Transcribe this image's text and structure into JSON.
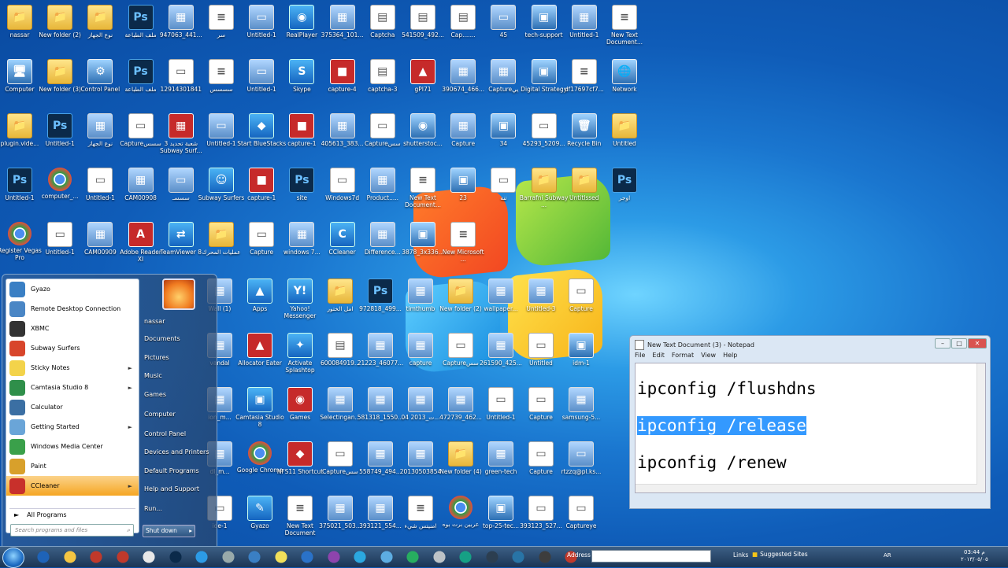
{
  "desktop": {
    "icons": [
      {
        "label": "nassar",
        "glyph": "📁",
        "kind": "g-folder"
      },
      {
        "label": "New folder (2)",
        "glyph": "📁",
        "kind": "g-folder"
      },
      {
        "label": "نوع الجهاز",
        "glyph": "📁",
        "kind": "g-folder"
      },
      {
        "label": "ملف الطباعة",
        "glyph": "Ps",
        "kind": "g-ps"
      },
      {
        "label": "947063_441...",
        "glyph": "▦",
        "kind": "g-img"
      },
      {
        "label": "سر",
        "glyph": "≡",
        "kind": "g-doc"
      },
      {
        "label": "Untitled-1",
        "glyph": "▭",
        "kind": "g-img"
      },
      {
        "label": "RealPlayer",
        "glyph": "◉",
        "kind": "g-app"
      },
      {
        "label": "375364_101...",
        "glyph": "▦",
        "kind": "g-img"
      },
      {
        "label": "Captcha",
        "glyph": "▤",
        "kind": "g-doc"
      },
      {
        "label": "541509_492...",
        "glyph": "▤",
        "kind": "g-doc"
      },
      {
        "label": "Cap.......",
        "glyph": "▤",
        "kind": "g-doc"
      },
      {
        "label": "45",
        "glyph": "▭",
        "kind": "g-img"
      },
      {
        "label": "tech-support",
        "glyph": "▣",
        "kind": "g-comp"
      },
      {
        "label": "Untitled-1",
        "glyph": "▦",
        "kind": "g-img"
      },
      {
        "label": "New Text Document...",
        "glyph": "≡",
        "kind": "g-doc"
      },
      {
        "label": "Computer",
        "glyph": "🖥",
        "kind": "g-comp"
      },
      {
        "label": "New folder (3)",
        "glyph": "📁",
        "kind": "g-folder"
      },
      {
        "label": "Control Panel",
        "glyph": "⚙",
        "kind": "g-comp"
      },
      {
        "label": "ملف الطباعة",
        "glyph": "Ps",
        "kind": "g-ps"
      },
      {
        "label": "12914301841",
        "glyph": "▭",
        "kind": "g-doc"
      },
      {
        "label": "سسسس",
        "glyph": "≡",
        "kind": "g-doc"
      },
      {
        "label": "Untitled-1",
        "glyph": "▭",
        "kind": "g-img"
      },
      {
        "label": "Skype",
        "glyph": "S",
        "kind": "g-app"
      },
      {
        "label": "capture-4",
        "glyph": "■",
        "kind": "g-red"
      },
      {
        "label": "captcha-3",
        "glyph": "▤",
        "kind": "g-doc"
      },
      {
        "label": "gPI71",
        "glyph": "▲",
        "kind": "g-red"
      },
      {
        "label": "390674_466...",
        "glyph": "▦",
        "kind": "g-img"
      },
      {
        "label": "Captureيي",
        "glyph": "▦",
        "kind": "g-img"
      },
      {
        "label": "Digital Strategy",
        "glyph": "▣",
        "kind": "g-comp"
      },
      {
        "label": "df17697cf7...",
        "glyph": "≡",
        "kind": "g-doc"
      },
      {
        "label": "Network",
        "glyph": "🌐",
        "kind": "g-comp"
      },
      {
        "label": "plugin.vide...",
        "glyph": "📁",
        "kind": "g-folder"
      },
      {
        "label": "Untitled-1",
        "glyph": "Ps",
        "kind": "g-ps"
      },
      {
        "label": "نوع الجهاز",
        "glyph": "▦",
        "kind": "g-img"
      },
      {
        "label": "Captureسسس",
        "glyph": "▭",
        "kind": "g-doc"
      },
      {
        "label": "شعبة تحديد 3 Subway Surf...",
        "glyph": "▦",
        "kind": "g-red"
      },
      {
        "label": "Untitled-1",
        "glyph": "▭",
        "kind": "g-img"
      },
      {
        "label": "Start BlueStacks",
        "glyph": "◆",
        "kind": "g-app"
      },
      {
        "label": "capture-1",
        "glyph": "■",
        "kind": "g-red"
      },
      {
        "label": "405613_383...",
        "glyph": "▦",
        "kind": "g-img"
      },
      {
        "label": "Captureسس",
        "glyph": "▭",
        "kind": "g-doc"
      },
      {
        "label": "shutterstoc...",
        "glyph": "◉",
        "kind": "g-comp"
      },
      {
        "label": "Capture",
        "glyph": "▦",
        "kind": "g-img"
      },
      {
        "label": "34",
        "glyph": "▣",
        "kind": "g-comp"
      },
      {
        "label": "45293_5209...",
        "glyph": "▭",
        "kind": "g-doc"
      },
      {
        "label": "Recycle Bin",
        "glyph": "🗑",
        "kind": "g-comp"
      },
      {
        "label": "Untitled",
        "glyph": "📁",
        "kind": "g-folder"
      },
      {
        "label": "Untitled-1",
        "glyph": "Ps",
        "kind": "g-ps"
      },
      {
        "label": "computer_...",
        "glyph": "",
        "kind": "g-chrome"
      },
      {
        "label": "Untitled-1",
        "glyph": "▭",
        "kind": "g-doc"
      },
      {
        "label": "CAM00908",
        "glyph": "▦",
        "kind": "g-img"
      },
      {
        "label": "سسسـ",
        "glyph": "▭",
        "kind": "g-img"
      },
      {
        "label": "Subway Surfers",
        "glyph": "☺",
        "kind": "g-app"
      },
      {
        "label": "capture-1",
        "glyph": "■",
        "kind": "g-red"
      },
      {
        "label": "site",
        "glyph": "Ps",
        "kind": "g-ps"
      },
      {
        "label": "Windows7d",
        "glyph": "▭",
        "kind": "g-doc"
      },
      {
        "label": "Product.....",
        "glyph": "▦",
        "kind": "g-img"
      },
      {
        "label": "New Text Document...",
        "glyph": "≡",
        "kind": "g-doc"
      },
      {
        "label": "23",
        "glyph": "▣",
        "kind": "g-comp"
      },
      {
        "label": "تنه",
        "glyph": "▭",
        "kind": "g-doc"
      },
      {
        "label": "Barrafni Subway ...",
        "glyph": "📁",
        "kind": "g-folder"
      },
      {
        "label": "Untitlssed",
        "glyph": "📁",
        "kind": "g-folder"
      },
      {
        "label": "اوجر",
        "glyph": "Ps",
        "kind": "g-ps"
      },
      {
        "label": "Register Vegas Pro",
        "glyph": "",
        "kind": "g-chrome"
      },
      {
        "label": "Untitled-1",
        "glyph": "▭",
        "kind": "g-doc"
      },
      {
        "label": "CAM00909",
        "glyph": "▦",
        "kind": "g-img"
      },
      {
        "label": "Adobe Reader XI",
        "glyph": "A",
        "kind": "g-red"
      },
      {
        "label": "TeamViewer 8",
        "glyph": "⇄",
        "kind": "g-app"
      },
      {
        "label": "عمليات المحرك",
        "glyph": "📁",
        "kind": "g-folder"
      },
      {
        "label": "Capture",
        "glyph": "▭",
        "kind": "g-doc"
      },
      {
        "label": "windows 7...",
        "glyph": "▦",
        "kind": "g-img"
      },
      {
        "label": "CCleaner",
        "glyph": "C",
        "kind": "g-app"
      },
      {
        "label": "Difference...",
        "glyph": "▦",
        "kind": "g-img"
      },
      {
        "label": "3878_3x336...",
        "glyph": "▣",
        "kind": "g-comp"
      },
      {
        "label": "New Microsoft ...",
        "glyph": "≡",
        "kind": "g-doc"
      }
    ],
    "icons_col2": [
      {
        "label": "Wall (1)",
        "glyph": "▦",
        "kind": "g-img"
      },
      {
        "label": "Apps",
        "glyph": "▲",
        "kind": "g-app"
      },
      {
        "label": "Yahoo! Messenger",
        "glyph": "Y!",
        "kind": "g-app"
      },
      {
        "label": "امل الختور",
        "glyph": "📁",
        "kind": "g-folder"
      },
      {
        "label": "972818_499...",
        "glyph": "Ps",
        "kind": "g-ps"
      },
      {
        "label": "timthumb",
        "glyph": "▦",
        "kind": "g-img"
      },
      {
        "label": "New folder (2)",
        "glyph": "📁",
        "kind": "g-folder"
      },
      {
        "label": "wallpaper...",
        "glyph": "▦",
        "kind": "g-img"
      },
      {
        "label": "Untitled-3",
        "glyph": "▦",
        "kind": "g-img"
      },
      {
        "label": "Capture",
        "glyph": "▭",
        "kind": "g-doc"
      },
      {
        "label": "vandal",
        "glyph": "▦",
        "kind": "g-img"
      },
      {
        "label": "Allocator Eater",
        "glyph": "▲",
        "kind": "g-red"
      },
      {
        "label": "Activate Splashtop",
        "glyph": "✦",
        "kind": "g-app"
      },
      {
        "label": "600084919...",
        "glyph": "▤",
        "kind": "g-doc"
      },
      {
        "label": "21223_46077...",
        "glyph": "▦",
        "kind": "g-img"
      },
      {
        "label": "capture",
        "glyph": "▦",
        "kind": "g-img"
      },
      {
        "label": "Captureسس",
        "glyph": "▭",
        "kind": "g-doc"
      },
      {
        "label": "261590_425...",
        "glyph": "▦",
        "kind": "g-img"
      },
      {
        "label": "Untitled",
        "glyph": "▭",
        "kind": "g-doc"
      },
      {
        "label": "idm-1",
        "glyph": "▣",
        "kind": "g-comp"
      },
      {
        "label": "ion_m...",
        "glyph": "▦",
        "kind": "g-img"
      },
      {
        "label": "Camtasia Studio 8",
        "glyph": "▣",
        "kind": "g-app"
      },
      {
        "label": "Games",
        "glyph": "◉",
        "kind": "g-red"
      },
      {
        "label": "Selectingan...",
        "glyph": "▦",
        "kind": "g-img"
      },
      {
        "label": "581318_1550...",
        "glyph": "▦",
        "kind": "g-img"
      },
      {
        "label": "ت_2013 04...",
        "glyph": "▦",
        "kind": "g-img"
      },
      {
        "label": "472739_462...",
        "glyph": "▦",
        "kind": "g-img"
      },
      {
        "label": "Untitled-1",
        "glyph": "▭",
        "kind": "g-doc"
      },
      {
        "label": "Capture",
        "glyph": "▭",
        "kind": "g-doc"
      },
      {
        "label": "samsung-5...",
        "glyph": "▦",
        "kind": "g-img"
      },
      {
        "label": "dl_m...",
        "glyph": "▦",
        "kind": "g-img"
      },
      {
        "label": "Google Chrome",
        "glyph": "",
        "kind": "g-chrome"
      },
      {
        "label": "NFS11 Shortcut",
        "glyph": "◆",
        "kind": "g-red"
      },
      {
        "label": "Captureسس",
        "glyph": "▭",
        "kind": "g-doc"
      },
      {
        "label": "558749_494...",
        "glyph": "▦",
        "kind": "g-img"
      },
      {
        "label": "20130503854",
        "glyph": "▦",
        "kind": "g-img"
      },
      {
        "label": "New folder (4)",
        "glyph": "📁",
        "kind": "g-folder"
      },
      {
        "label": "green-tech",
        "glyph": "▦",
        "kind": "g-img"
      },
      {
        "label": "Capture",
        "glyph": "▭",
        "kind": "g-doc"
      },
      {
        "label": "rtzzq@pl.ks...",
        "glyph": "▭",
        "kind": "g-img"
      },
      {
        "label": "ide-1",
        "glyph": "▭",
        "kind": "g-doc"
      },
      {
        "label": "Gyazo",
        "glyph": "✎",
        "kind": "g-app"
      },
      {
        "label": "New Text Document",
        "glyph": "≡",
        "kind": "g-doc"
      },
      {
        "label": "375021_503...",
        "glyph": "▦",
        "kind": "g-img"
      },
      {
        "label": "393121_554...",
        "glyph": "▦",
        "kind": "g-img"
      },
      {
        "label": "امنيتس شيء",
        "glyph": "≡",
        "kind": "g-doc"
      },
      {
        "label": "عربين برت بوه",
        "glyph": "",
        "kind": "g-chrome"
      },
      {
        "label": "top-25-tec...",
        "glyph": "▣",
        "kind": "g-comp"
      },
      {
        "label": "393123_527...",
        "glyph": "▭",
        "kind": "g-doc"
      },
      {
        "label": "Captureye",
        "glyph": "▭",
        "kind": "g-doc"
      }
    ]
  },
  "start_menu": {
    "programs": [
      {
        "label": "Gyazo",
        "color": "#3a7fc4",
        "arrow": ""
      },
      {
        "label": "Remote Desktop Connection",
        "color": "#4a86c5",
        "arrow": ""
      },
      {
        "label": "XBMC",
        "color": "#333333",
        "arrow": ""
      },
      {
        "label": "Subway Surfers",
        "color": "#d8452b",
        "arrow": ""
      },
      {
        "label": "Sticky Notes",
        "color": "#f3d34a",
        "arrow": "►"
      },
      {
        "label": "Camtasia Studio 8",
        "color": "#2f8f4a",
        "arrow": "►"
      },
      {
        "label": "Calculator",
        "color": "#3b6fa3",
        "arrow": ""
      },
      {
        "label": "Getting Started",
        "color": "#6aa5d8",
        "arrow": "►"
      },
      {
        "label": "Windows Media Center",
        "color": "#3aa04a",
        "arrow": ""
      },
      {
        "label": "Paint",
        "color": "#d8a02b",
        "arrow": ""
      },
      {
        "label": "CCleaner",
        "color": "#c8302b",
        "arrow": "►"
      }
    ],
    "all_programs": "All Programs",
    "search_placeholder": "Search programs and files",
    "right": [
      "nassar",
      "Documents",
      "Pictures",
      "Music",
      "Games",
      "Computer",
      "Control Panel",
      "Devices and Printers",
      "Default Programs",
      "Help and Support",
      "Run..."
    ],
    "shutdown": "Shut down"
  },
  "notepad": {
    "title": "New Text Document (3) - Notepad",
    "menu": [
      "File",
      "Edit",
      "Format",
      "View",
      "Help"
    ],
    "lines": [
      "ipconfig /flushdns",
      "ipconfig /release",
      "ipconfig /renew"
    ]
  },
  "taskbar": {
    "address_label": "Address",
    "links_label": "Links",
    "suggested": "Suggested Sites",
    "lang": "AR",
    "time": "03:44 م",
    "date": "٢٠١٣/٠٥/٠٥"
  }
}
